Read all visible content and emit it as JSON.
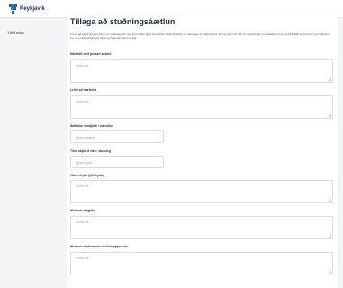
{
  "app": {
    "brand": "Reykjavík"
  },
  "sidebar": {
    "items": [
      {
        "label": "Yfirlit mála"
      }
    ]
  },
  "page": {
    "title": "Tillaga að stuðningsáætlun",
    "intro": "Þú ert að fylgja umsókn þinni um stuðning eftir. Hér fyrir neðan getur þú tiltekið markmið, leiðir og væntingar til stuðningsins. Einnig getur þú fyllt inn upplýsingar um áætlaðan tíma og tíðni. Eftir að þú hefur sent tillöguna inn mun ráðgjafi fara yfir hana og hafa samband við þig."
  },
  "form": {
    "goals": {
      "label": "Markmið með þessari aðstoð",
      "placeholder": "Skrifa hér..."
    },
    "means": {
      "label": "Leiðir að markmiði",
      "placeholder": "Skrifa hér..."
    },
    "duration": {
      "label": "Áætlaður tímafjöldi / mánuður",
      "placeholder": "Fjöldi mánaða"
    },
    "frequency": {
      "label": "Tíðni skipta á viku / stuðning",
      "placeholder": "Fjöldi skipta"
    },
    "role_family": {
      "label": "Hlutverk þitt (fjölskyldu)",
      "placeholder": "Skrifa hér..."
    },
    "role_advisor": {
      "label": "Hlutverk ráðgjafa",
      "placeholder": "Skrifa hér..."
    },
    "role_staff": {
      "label": "Hlutverk starfsmanns stuðningsþjónustu",
      "placeholder": "Skrifa hér..."
    }
  }
}
